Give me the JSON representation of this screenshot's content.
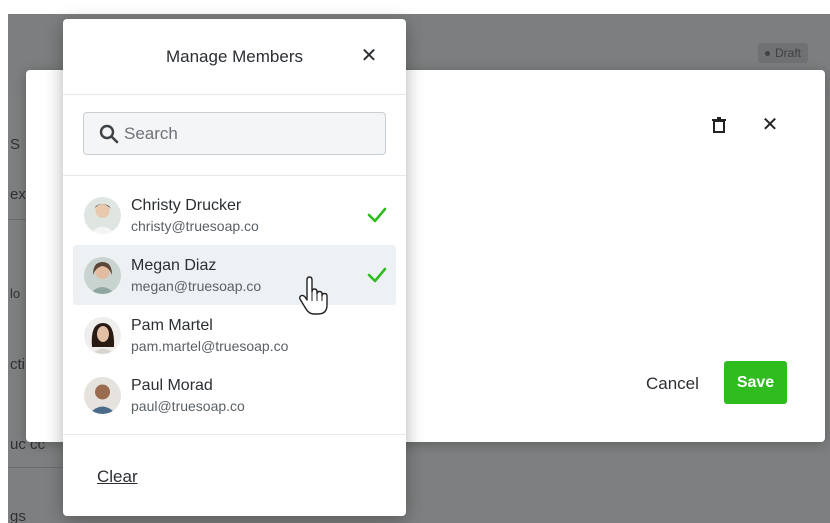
{
  "background": {
    "draft_badge": "Draft",
    "fragments": [
      "S",
      "ext",
      "lo",
      "cti",
      "uc cc",
      "gs"
    ]
  },
  "dialog": {
    "cancel_label": "Cancel",
    "save_label": "Save",
    "save_color": "#2ebc1f"
  },
  "popover": {
    "title": "Manage Members",
    "search_placeholder": "Search",
    "clear_label": "Clear",
    "members": [
      {
        "name": "Christy Drucker",
        "email": "christy@truesoap.co",
        "selected": true
      },
      {
        "name": "Megan Diaz",
        "email": "megan@truesoap.co",
        "selected": true
      },
      {
        "name": "Pam Martel",
        "email": "pam.martel@truesoap.co",
        "selected": false
      },
      {
        "name": "Paul Morad",
        "email": "paul@truesoap.co",
        "selected": false
      }
    ],
    "check_color": "#2ebc1f"
  }
}
